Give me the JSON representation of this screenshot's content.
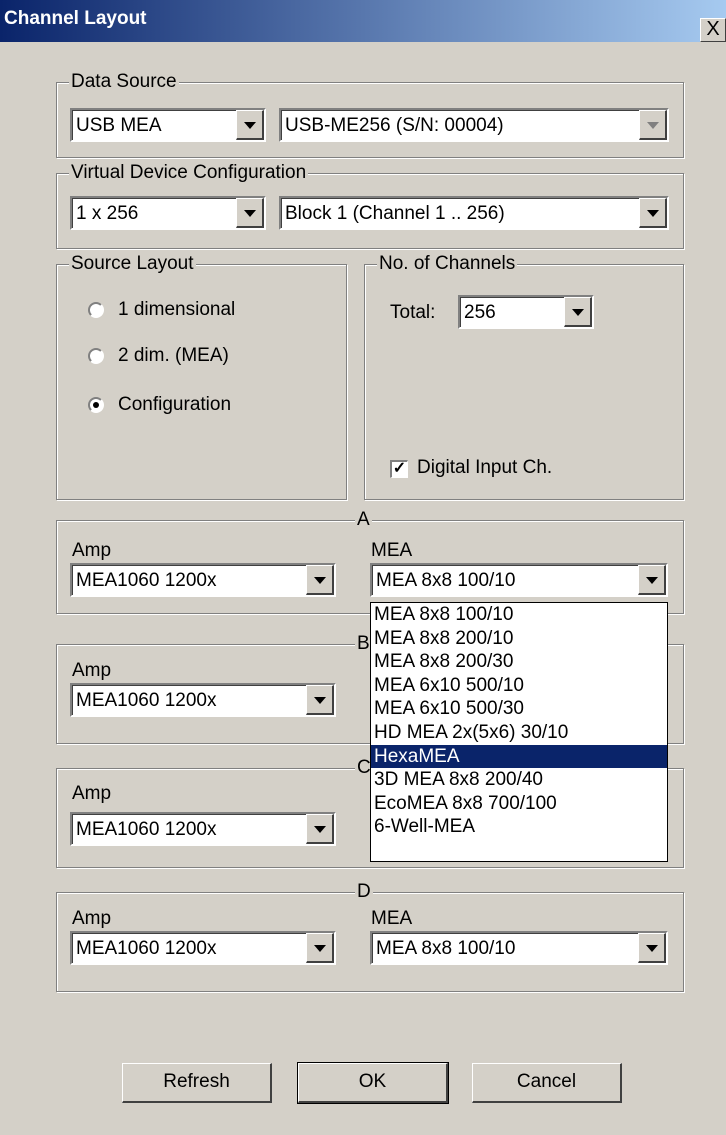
{
  "window": {
    "title": "Channel Layout",
    "close_glyph": "X"
  },
  "data_source": {
    "legend": "Data Source",
    "source_value": "USB MEA",
    "device_value": "USB-ME256  (S/N: 00004)"
  },
  "virtual_device": {
    "legend": "Virtual Device Configuration",
    "config_value": "1 x 256",
    "block_value": "Block 1 (Channel 1 .. 256)"
  },
  "source_layout": {
    "legend": "Source Layout",
    "options": [
      "1 dimensional",
      "2 dim. (MEA)",
      "Configuration"
    ],
    "selected": "Configuration"
  },
  "channels": {
    "legend": "No. of Channels",
    "total_label": "Total:",
    "total_value": "256",
    "digital_input_label": "Digital Input Ch.",
    "digital_input_checked": true
  },
  "headstages": [
    {
      "legend": "A",
      "amp_label": "Amp",
      "amp_value": "MEA1060 1200x",
      "mea_label": "MEA",
      "mea_value": "MEA 8x8 100/10"
    },
    {
      "legend": "B",
      "amp_label": "Amp",
      "amp_value": "MEA1060 1200x"
    },
    {
      "legend": "C",
      "amp_label": "Amp",
      "amp_value": "MEA1060 1200x"
    },
    {
      "legend": "D",
      "amp_label": "Amp",
      "amp_value": "MEA1060 1200x",
      "mea_label": "MEA",
      "mea_value": "MEA 8x8 100/10"
    }
  ],
  "mea_dropdown": {
    "options": [
      "MEA 8x8 100/10",
      "MEA 8x8 200/10",
      "MEA 8x8 200/30",
      "MEA 6x10 500/10",
      "MEA 6x10 500/30",
      "HD MEA 2x(5x6) 30/10",
      "HexaMEA",
      "3D MEA 8x8 200/40",
      "EcoMEA 8x8 700/100",
      "6-Well-MEA"
    ],
    "highlighted": "HexaMEA"
  },
  "buttons": {
    "refresh": "Refresh",
    "ok": "OK",
    "cancel": "Cancel"
  },
  "colors": {
    "face": "#d4d0c8",
    "title_start": "#0a246a",
    "title_end": "#a6caf0",
    "highlight": "#0a246a"
  }
}
